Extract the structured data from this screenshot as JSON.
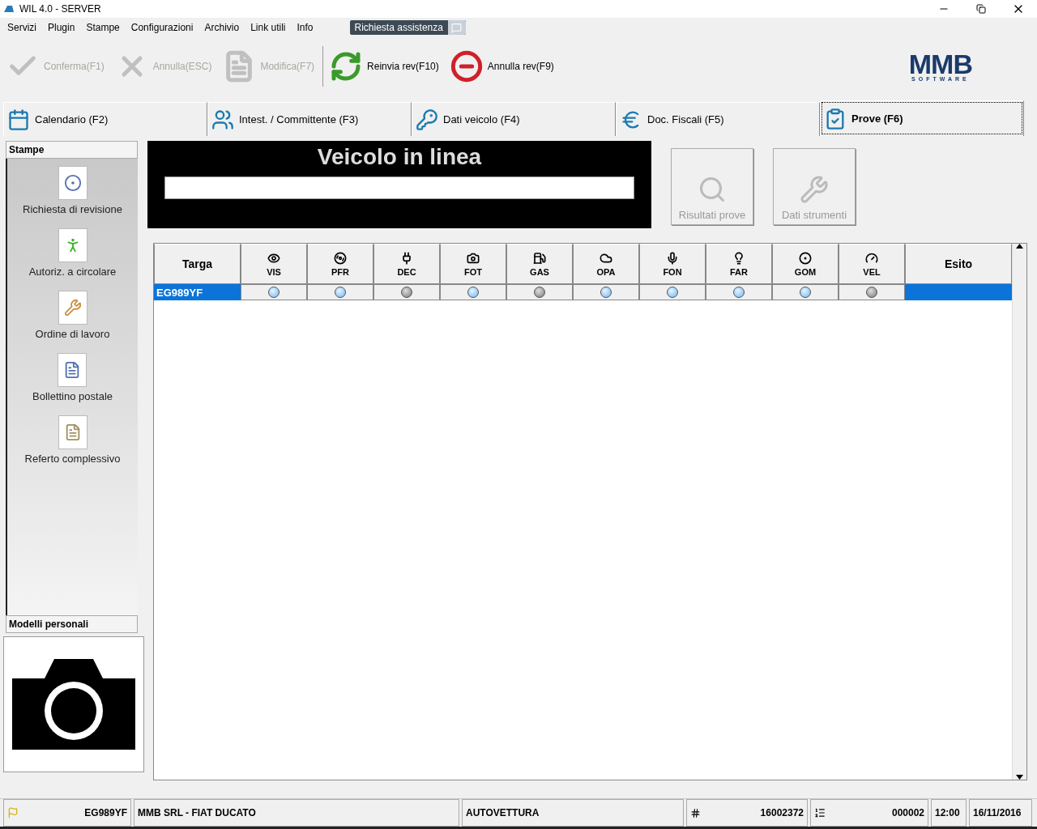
{
  "window": {
    "title": "WIL 4.0 - SERVER"
  },
  "menu": [
    "Servizi",
    "Plugin",
    "Stampe",
    "Configurazioni",
    "Archivio",
    "Link utili",
    "Info"
  ],
  "assist_button": {
    "label": "Richiesta assistenza"
  },
  "toolbar": [
    {
      "label": "Conferma(F1)",
      "disabled": true
    },
    {
      "label": "Annulla(ESC)",
      "disabled": true
    },
    {
      "label": "Modifica(F7)",
      "disabled": true
    },
    {
      "label": "Reinvia rev(F10)",
      "disabled": false
    },
    {
      "label": "Annulla rev(F9)",
      "disabled": false
    }
  ],
  "logo": {
    "name": "MMB",
    "tagline": "SOFTWARE"
  },
  "tabs": [
    {
      "label": "Calendario (F2)",
      "selected": false
    },
    {
      "label": "Intest. / Committente (F3)",
      "selected": false
    },
    {
      "label": "Dati veicolo (F4)",
      "selected": false
    },
    {
      "label": "Doc. Fiscali (F5)",
      "selected": false
    },
    {
      "label": "Prove (F6)",
      "selected": true
    }
  ],
  "sidebar": {
    "title": "Stampe",
    "items": [
      "Richiesta di revisione",
      "Autoriz. a circolare",
      "Ordine di lavoro",
      "Bollettino postale",
      "Referto complessivo"
    ],
    "models_title": "Modelli personali"
  },
  "vehicle_panel": {
    "title": "Veicolo in linea"
  },
  "action_buttons": [
    {
      "label": "Risultati prove",
      "disabled": true
    },
    {
      "label": "Dati strumenti",
      "disabled": true
    }
  ],
  "table": {
    "first_column": "Targa",
    "last_column": "Esito",
    "tests": [
      {
        "label": "VIS",
        "active": true
      },
      {
        "label": "PFR",
        "active": true
      },
      {
        "label": "DEC",
        "active": false
      },
      {
        "label": "FOT",
        "active": true
      },
      {
        "label": "GAS",
        "active": false
      },
      {
        "label": "OPA",
        "active": true
      },
      {
        "label": "FON",
        "active": true
      },
      {
        "label": "FAR",
        "active": true
      },
      {
        "label": "GOM",
        "active": true
      },
      {
        "label": "VEL",
        "active": false
      }
    ],
    "rows": [
      {
        "plate": "EG989YF",
        "selected": true
      }
    ]
  },
  "status_bar": {
    "plate": "EG989YF",
    "owner": "MMB SRL - FIAT DUCATO",
    "category": "AUTOVETTURA",
    "number": "16002372",
    "counter": "000002",
    "time": "12:00",
    "date": "16/11/2016"
  }
}
